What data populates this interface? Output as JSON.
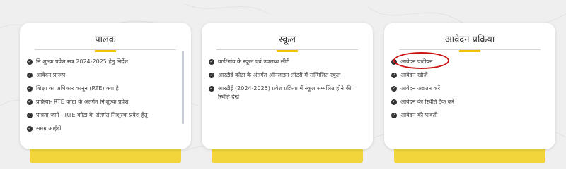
{
  "cards": [
    {
      "title": "पालक",
      "items": [
        "नि:शुल्क प्रवेश सत्र 2024-2025 हेतु निर्देश",
        "आवेदन प्रारूप",
        "शिक्षा का अधिकार कानून (RTE) क्या है",
        "प्रक्रिया- RTE कोटा के अंतर्गत निःशुल्क प्रवेश",
        "पात्रता जाने - RTE कोटा के अंतर्गत निःशुल्क प्रवेश हेतु",
        "समग्र आईडी"
      ]
    },
    {
      "title": "स्कूल",
      "items": [
        "वार्ड/गांव के स्कूल एवं उपलब्ध सीटें",
        "आरटीई कोटा के अंतर्गत ऑनलाइन लॉटरी में सम्मिलित स्कूल",
        "आरटीई (2024-2025) प्रवेश प्रक्रिया में स्कूल सम्मलित होने की स्थिति देखें"
      ]
    },
    {
      "title": "आवेदन प्रक्रिया",
      "items": [
        "आवेदन पंजीयन",
        "आवेदन खोजें",
        "आवेदन अद्यतन करें",
        "आवेदन की स्थिति ट्रैक करें",
        "आवेदन की पावती"
      ]
    }
  ],
  "icons": {
    "bullet": "check-circle-icon"
  },
  "colors": {
    "accent": "#f2c200",
    "highlight": "#cc1111"
  }
}
